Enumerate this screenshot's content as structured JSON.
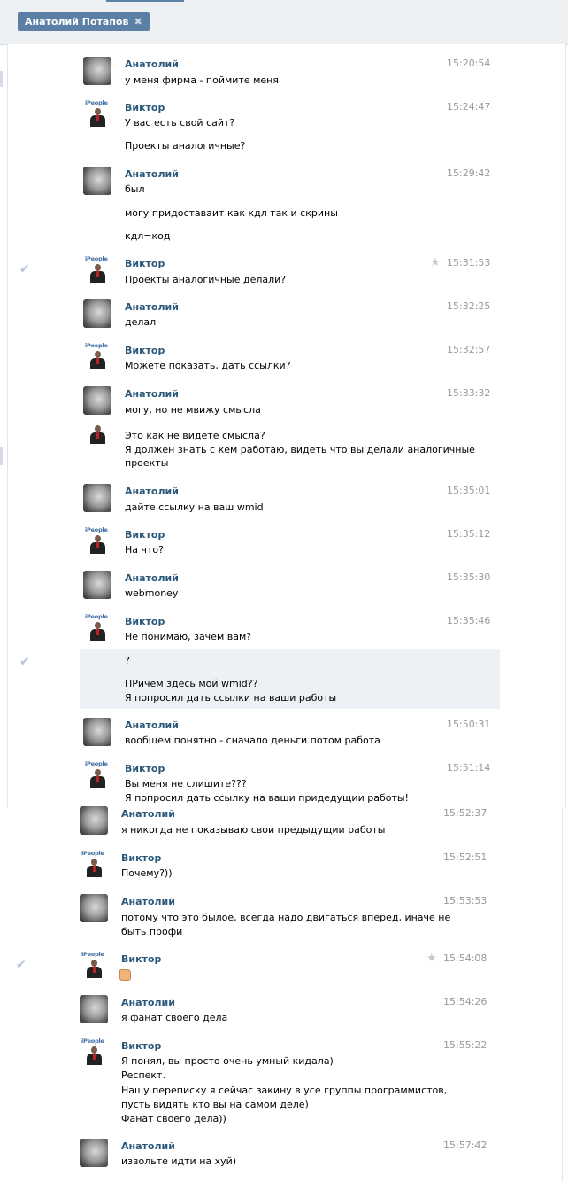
{
  "header": {
    "tab_label": "Анатолий Потапов",
    "close_glyph": "✖"
  },
  "icons": {
    "check": "✔",
    "star": "★"
  },
  "messages": [
    {
      "name": "Анатолий",
      "time": "15:20:54",
      "lines": [
        "у меня фирма - поймите меня"
      ]
    },
    {
      "name": "Виктор",
      "time": "15:24:47",
      "lines": [
        "У вас есть свой сайт?",
        "Проекты аналогичные?"
      ]
    },
    {
      "name": "Анатолий",
      "time": "15:29:42",
      "lines": [
        "был",
        "могу придоставаит как кдл так и скрины",
        "кдл=код"
      ]
    },
    {
      "name": "Виктор",
      "time": "15:31:53",
      "lines": [
        "Проекты аналогичные делали?"
      ]
    },
    {
      "name": "Анатолий",
      "time": "15:32:25",
      "lines": [
        "делал"
      ]
    },
    {
      "name": "Виктор",
      "time": "15:32:57",
      "lines": [
        "Можете показать, дать ссылки?"
      ]
    },
    {
      "name": "Анатолий",
      "time": "15:33:32",
      "lines": [
        "могу, но не мвижу смысла"
      ]
    },
    {
      "name": "",
      "time": "",
      "lines": [
        "Это как не видете смысла?",
        "Я должен знать с кем работаю, видеть что вы делали аналогичные",
        "проекты"
      ]
    },
    {
      "name": "Анатолий",
      "time": "15:35:01",
      "lines": [
        "дайте ссылку на ваш wmid"
      ]
    },
    {
      "name": "Виктор",
      "time": "15:35:12",
      "lines": [
        "На что?"
      ]
    },
    {
      "name": "Анатолий",
      "time": "15:35:30",
      "lines": [
        "webmoney"
      ]
    },
    {
      "name": "Виктор",
      "time": "15:35:46",
      "lines": [
        "Не понимаю, зачем вам?"
      ]
    },
    {
      "name": "",
      "time": "",
      "lines": [
        "?",
        "ПРичем здесь мой wmid??",
        "Я попросил дать ссылки на ваши работы"
      ]
    },
    {
      "name": "Анатолий",
      "time": "15:50:31",
      "lines": [
        "вообщем понятно - сначало деньги потом работа"
      ]
    },
    {
      "name": "Виктор",
      "time": "15:51:14",
      "lines": [
        "Вы меня не слишите???",
        "Я попросил дать ссылку на ваши придедущии работы!"
      ]
    },
    {
      "name": "Анатолий",
      "time": "15:52:37",
      "lines": [
        "я никогда не показываю свои предыдущии работы"
      ]
    },
    {
      "name": "Виктор",
      "time": "15:52:51",
      "lines": [
        "Почему?))"
      ]
    },
    {
      "name": "Анатолий",
      "time": "15:53:53",
      "lines": [
        "потому что это былое, всегда надо двигаться вперед, иначе не",
        "быть профи"
      ]
    },
    {
      "name": "Виктор",
      "time": "15:54:08",
      "lines": []
    },
    {
      "name": "Анатолий",
      "time": "15:54:26",
      "lines": [
        "я фанат своего дела"
      ]
    },
    {
      "name": "Виктор",
      "time": "15:55:22",
      "lines": [
        "Я понял, вы просто очень умный кидала)",
        "Респект.",
        "Нашу переписку я сейчас закину в усе группы программистов,",
        "пусть видять кто вы на самом деле)",
        "Фанат своего дела))"
      ]
    },
    {
      "name": "Анатолий",
      "time": "15:57:42",
      "lines": [
        "извольте идти на хуй)"
      ]
    }
  ]
}
